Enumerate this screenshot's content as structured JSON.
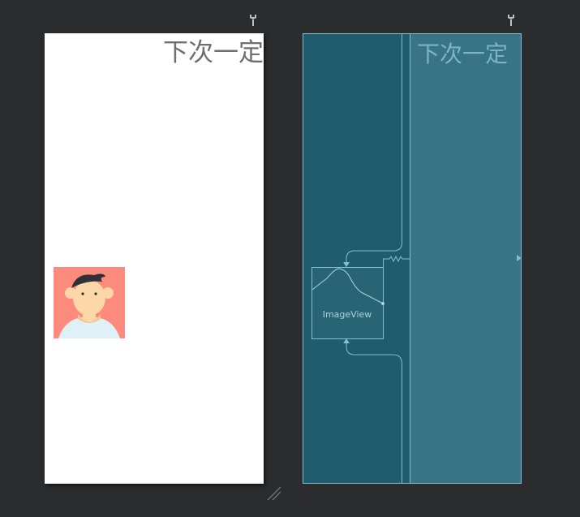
{
  "design_view": {
    "text_label": "下次一定",
    "image_icon": "avatar-illustration"
  },
  "blueprint_view": {
    "text_label": "下次一定",
    "image_view_label": "ImageView"
  },
  "icons": {
    "layout_settings": "wrench-icon",
    "resize": "resize-handle-icon"
  },
  "colors": {
    "canvas_background": "#2b2c2e",
    "design_background": "#ffffff",
    "blueprint_background": "#215c6e",
    "blueprint_highlight": "#387485",
    "blueprint_lines": "#7fc0d0",
    "avatar_background": "#fc8b7d"
  }
}
